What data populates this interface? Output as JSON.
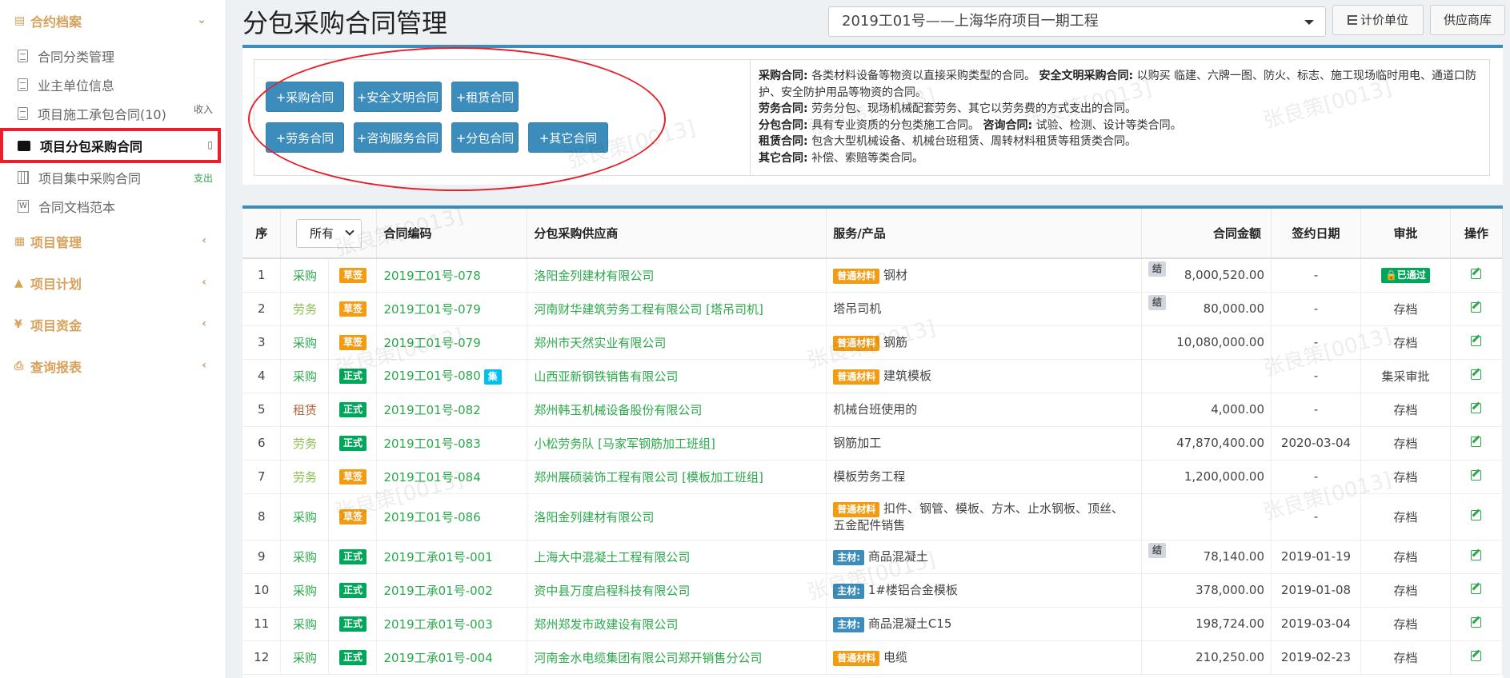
{
  "sidebar": {
    "group1": "合约档案",
    "items": [
      {
        "label": "合同分类管理"
      },
      {
        "label": "业主单位信息"
      },
      {
        "label": "项目施工承包合同(10)",
        "badge": "收入"
      },
      {
        "label": "项目分包采购合同"
      },
      {
        "label": "项目集中采购合同",
        "badge": "支出"
      },
      {
        "label": "合同文档范本"
      }
    ],
    "groups": [
      "项目管理",
      "项目计划",
      "项目资金",
      "查询报表"
    ]
  },
  "header": {
    "title": "分包采购合同管理",
    "project": "2019工01号——上海华府项目一期工程",
    "unit_btn": "计价单位",
    "store_btn": "供应商库"
  },
  "buttons": [
    "+采购合同",
    "+安全文明合同",
    "+租赁合同",
    "+劳务合同",
    "+咨询服务合同",
    "+分包合同",
    "+其它合同"
  ],
  "desc": [
    {
      "k": "采购合同:",
      "v": "各类材料设备等物资以直接采购类型的合同。"
    },
    {
      "k": "安全文明采购合同:",
      "v": "以购买 临建、六牌一图、防火、标志、施工现场临时用电、通道口防护、安全防护用品等物资的合同。"
    },
    {
      "k": "劳务合同:",
      "v": "劳务分包、现场机械配套劳务、其它以劳务费的方式支出的合同。"
    },
    {
      "k": "分包合同:",
      "v": "具有专业资质的分包类施工合同。"
    },
    {
      "k": "咨询合同:",
      "v": "试验、检测、设计等类合同。"
    },
    {
      "k": "租赁合同:",
      "v": "包含大型机械设备、机械台班租赁、周转材料租赁等租赁类合同。"
    },
    {
      "k": "其它合同:",
      "v": "补偿、索赔等类合同。"
    }
  ],
  "table": {
    "headers": [
      "序",
      "所有",
      "合同编码",
      "分包采购供应商",
      "服务/产品",
      "合同金额",
      "签约日期",
      "审批",
      "操作"
    ],
    "rows": [
      {
        "n": "1",
        "type": "采购",
        "tcls": "cg",
        "status": "草签",
        "code": "2019工01号-078",
        "sup": "洛阳金列建材有限公司",
        "ptag": "普通材料",
        "prod": "钢材",
        "jie": "结",
        "amt": "8,000,520.00",
        "date": "-",
        "appr": "已通过"
      },
      {
        "n": "2",
        "type": "劳务",
        "tcls": "lw",
        "status": "草签",
        "code": "2019工01号-079",
        "sup": "河南财华建筑劳务工程有限公司 [塔吊司机]",
        "ptag": "",
        "prod": "塔吊司机",
        "jie": "结",
        "amt": "80,000.00",
        "date": "-",
        "appr": "存档"
      },
      {
        "n": "3",
        "type": "采购",
        "tcls": "cg",
        "status": "草签",
        "code": "2019工01号-079",
        "sup": "郑州市天然实业有限公司",
        "ptag": "普通材料",
        "prod": "钢筋",
        "jie": "",
        "amt": "10,080,000.00",
        "date": "-",
        "appr": "存档"
      },
      {
        "n": "4",
        "type": "采购",
        "tcls": "cg",
        "status": "正式",
        "code": "2019工01号-080",
        "ji": "集",
        "sup": "山西亚新钢铁销售有限公司",
        "ptag": "普通材料",
        "prod": "建筑模板",
        "jie": "",
        "amt": "",
        "date": "-",
        "appr": "集采审批"
      },
      {
        "n": "5",
        "type": "租赁",
        "tcls": "zl",
        "status": "正式",
        "code": "2019工01号-082",
        "sup": "郑州韩玉机械设备股份有限公司",
        "ptag": "",
        "prod": "机械台班使用的",
        "jie": "",
        "amt": "4,000.00",
        "date": "-",
        "appr": "存档"
      },
      {
        "n": "6",
        "type": "劳务",
        "tcls": "lw",
        "status": "正式",
        "code": "2019工01号-083",
        "sup": "小松劳务队 [马家军钢筋加工班组]",
        "ptag": "",
        "prod": "钢筋加工",
        "jie": "",
        "amt": "47,870,400.00",
        "date": "2020-03-04",
        "appr": "存档"
      },
      {
        "n": "7",
        "type": "劳务",
        "tcls": "lw",
        "status": "草签",
        "code": "2019工01号-084",
        "sup": "郑州展硕装饰工程有限公司 [模板加工班组]",
        "ptag": "",
        "prod": "模板劳务工程",
        "jie": "",
        "amt": "1,200,000.00",
        "date": "-",
        "appr": "存档"
      },
      {
        "n": "8",
        "type": "采购",
        "tcls": "cg",
        "status": "草签",
        "code": "2019工01号-086",
        "sup": "洛阳金列建材有限公司",
        "ptag": "普通材料",
        "prod": "扣件、钢管、模板、方木、止水钢板、顶丝、五金配件销售",
        "jie": "",
        "amt": "",
        "date": "-",
        "appr": "存档",
        "tall": true
      },
      {
        "n": "9",
        "type": "采购",
        "tcls": "cg",
        "status": "正式",
        "code": "2019工承01号-001",
        "sup": "上海大中混凝土工程有限公司",
        "ptag": "主材:",
        "main": true,
        "prod": "商品混凝土",
        "jie": "结",
        "amt": "78,140.00",
        "date": "2019-01-19",
        "appr": "存档"
      },
      {
        "n": "10",
        "type": "采购",
        "tcls": "cg",
        "status": "正式",
        "code": "2019工承01号-002",
        "sup": "资中县万度启程科技有限公司",
        "ptag": "主材:",
        "main": true,
        "prod": "1#楼铝合金模板",
        "jie": "",
        "amt": "378,000.00",
        "date": "2019-01-08",
        "appr": "存档"
      },
      {
        "n": "11",
        "type": "采购",
        "tcls": "cg",
        "status": "正式",
        "code": "2019工承01号-003",
        "sup": "郑州郑发市政建设有限公司",
        "ptag": "主材:",
        "main": true,
        "prod": "商品混凝土C15",
        "jie": "",
        "amt": "198,724.00",
        "date": "2019-03-04",
        "appr": "存档"
      },
      {
        "n": "12",
        "type": "采购",
        "tcls": "cg",
        "status": "正式",
        "code": "2019工承01号-004",
        "sup": "河南金水电缆集团有限公司郑开销售分公司",
        "ptag": "普通材料",
        "prod": "电缆",
        "jie": "",
        "amt": "210,250.00",
        "date": "2019-02-23",
        "appr": "存档"
      }
    ]
  },
  "watermark": "张良策[0013]",
  "colors": {
    "accent": "#3c8dbc",
    "green": "#00a65a",
    "orange": "#f39c12",
    "highlight": "#e8202a"
  }
}
